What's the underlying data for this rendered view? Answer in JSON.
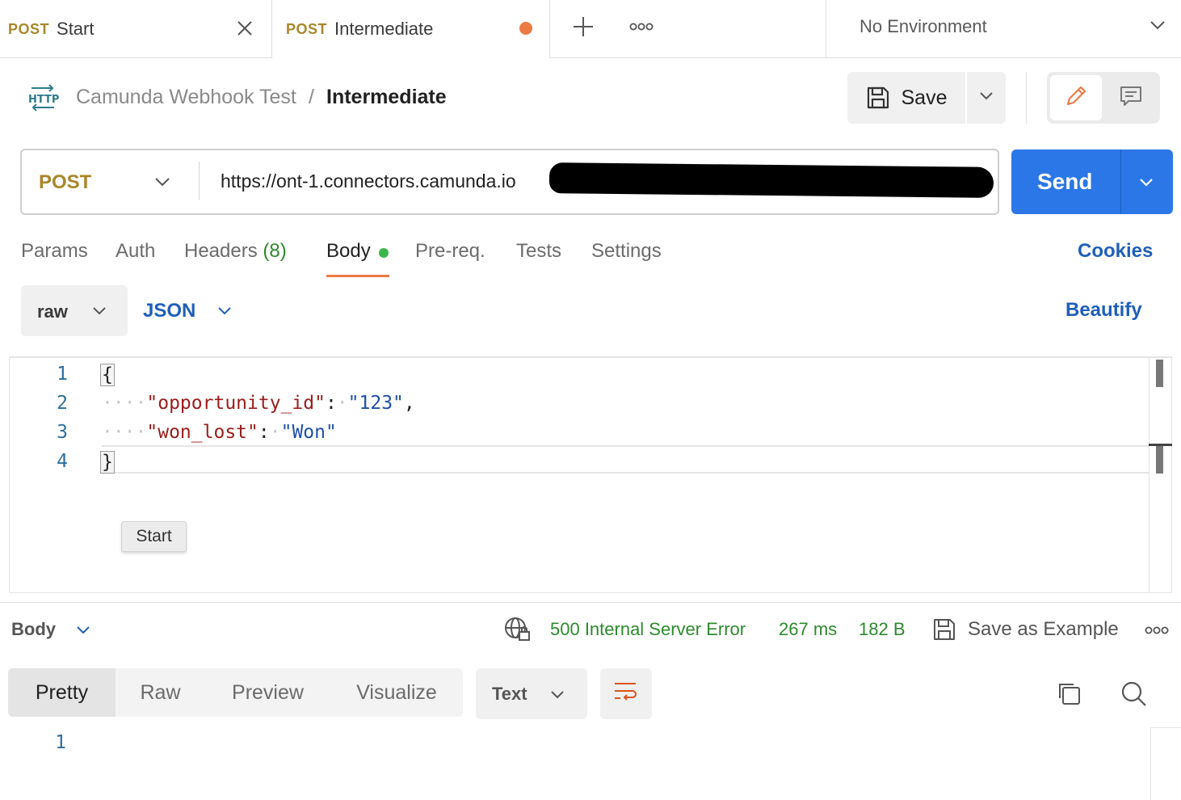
{
  "tabs": [
    {
      "method": "POST",
      "name": "Start"
    },
    {
      "method": "POST",
      "name": "Intermediate"
    }
  ],
  "environment": {
    "selected": "No Environment"
  },
  "breadcrumb": {
    "badge": "HTTP",
    "collection": "Camunda Webhook Test",
    "separator": "/",
    "current": "Intermediate"
  },
  "toolbar": {
    "save_label": "Save"
  },
  "request": {
    "method": "POST",
    "url": "https://ont-1.connectors.camunda.io",
    "send_label": "Send"
  },
  "request_tabs": {
    "params": "Params",
    "auth": "Auth",
    "headers": "Headers",
    "headers_count": "(8)",
    "body": "Body",
    "prereq": "Pre-req.",
    "tests": "Tests",
    "settings": "Settings",
    "cookies": "Cookies"
  },
  "body_options": {
    "mode": "raw",
    "language": "JSON",
    "beautify": "Beautify"
  },
  "editor": {
    "line_numbers": [
      "1",
      "2",
      "3",
      "4"
    ],
    "open_brace": "{",
    "close_brace": "}",
    "key1": "\"opportunity_id\"",
    "val1": "\"123\"",
    "key2": "\"won_lost\"",
    "val2": "\"Won\"",
    "colon": ":",
    "comma": ",",
    "tooltip": "Start"
  },
  "response": {
    "body_label": "Body",
    "status": "500 Internal Server Error",
    "time": "267 ms",
    "size": "182 B",
    "save_example": "Save as Example",
    "views": [
      "Pretty",
      "Raw",
      "Preview",
      "Visualize"
    ],
    "format": "Text",
    "line_numbers": [
      "1"
    ]
  },
  "colors": {
    "accent": "#2b77e8",
    "method": "#a8872a",
    "orange": "#ec7a45",
    "green": "#2d8a2d",
    "link": "#1f5fb8"
  }
}
